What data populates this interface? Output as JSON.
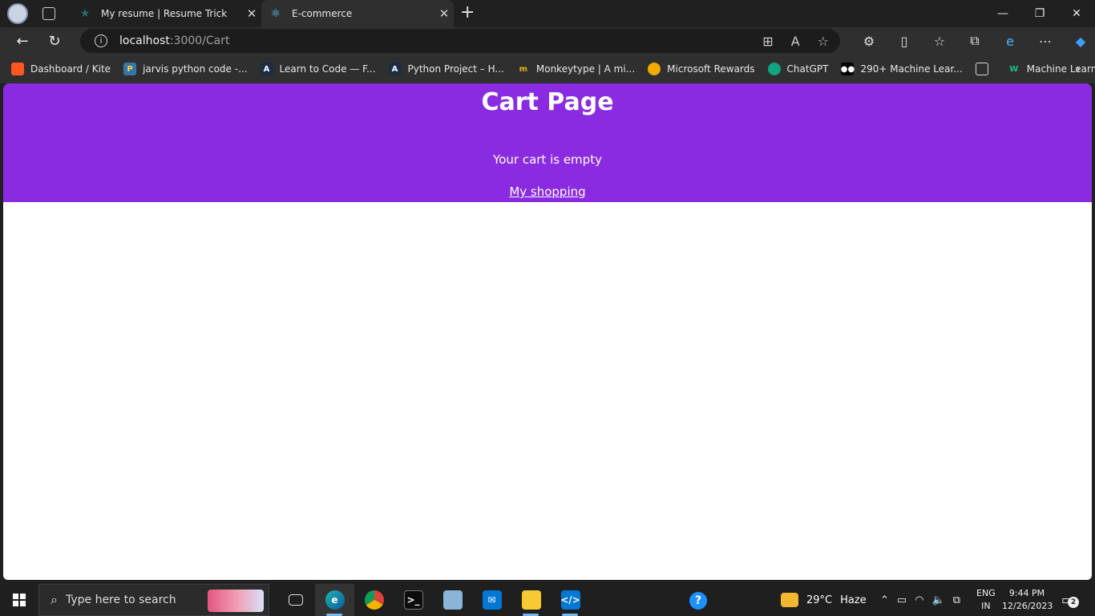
{
  "browser": {
    "tabs": [
      {
        "title": "My resume | Resume Trick",
        "active": false,
        "icon": "star-icon"
      },
      {
        "title": "E-commerce",
        "active": true,
        "icon": "react-icon"
      }
    ],
    "new_tab_glyph": "+",
    "address": {
      "host": "localhost",
      "path": ":3000/Cart"
    },
    "bookmarks": [
      {
        "label": "Dashboard / Kite",
        "icon": "kite-icon",
        "color": "#ff5722"
      },
      {
        "label": "jarvis python code -...",
        "icon": "python-icon",
        "color": "#3776ab"
      },
      {
        "label": "Learn to Code — F...",
        "icon": "codecademy-icon",
        "color": "#1f2a44"
      },
      {
        "label": "Python Project – H...",
        "icon": "codecademy-icon",
        "color": "#1f2a44"
      },
      {
        "label": "Monkeytype | A mi...",
        "icon": "monkeytype-icon",
        "color": "#e2b714"
      },
      {
        "label": "Microsoft Rewards",
        "icon": "medal-icon",
        "color": "#f2a900"
      },
      {
        "label": "ChatGPT",
        "icon": "chatgpt-icon",
        "color": "#10a37f"
      },
      {
        "label": "290+ Machine Lear...",
        "icon": "medium-icon",
        "color": "#000000"
      },
      {
        "label": "",
        "icon": "calendar-icon",
        "color": "#444444"
      },
      {
        "label": "Machine Learning I...",
        "icon": "w-icon",
        "color": "#19c37d"
      }
    ]
  },
  "page": {
    "title": "Cart Page",
    "empty_message": "Your cart is empty",
    "link_label": "My shopping",
    "header_color": "#8a2be2"
  },
  "taskbar": {
    "search_placeholder": "Type here to search",
    "apps": [
      {
        "name": "task-view-icon"
      },
      {
        "name": "edge-icon",
        "active": true
      },
      {
        "name": "chrome-icon"
      },
      {
        "name": "terminal-icon"
      },
      {
        "name": "notes-icon"
      },
      {
        "name": "mail-icon"
      },
      {
        "name": "file-explorer-icon"
      },
      {
        "name": "vscode-icon"
      }
    ],
    "help_glyph": "?",
    "weather": {
      "temp": "29°C",
      "condition": "Haze"
    },
    "language": {
      "line1": "ENG",
      "line2": "IN"
    },
    "clock": {
      "time": "9:44 PM",
      "date": "12/26/2023"
    },
    "notifications_count": "2"
  }
}
